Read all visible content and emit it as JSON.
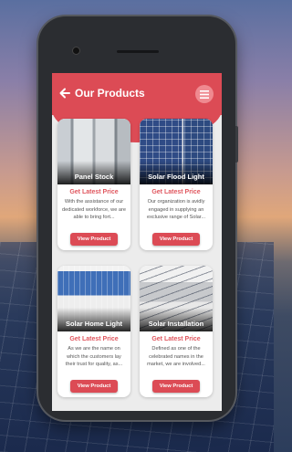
{
  "header": {
    "title": "Our Products",
    "back_icon": "arrow-left-icon",
    "menu_icon": "hamburger-menu-icon"
  },
  "colors": {
    "accent": "#dc4b55",
    "price": "#e0565e",
    "screen_bg": "#ececec"
  },
  "products": [
    {
      "name": "Panel Stock",
      "price_label": "Get Latest Price",
      "description": "With the assistance of our dedicated workforce, we are able to bring fort...",
      "button_label": "View Product"
    },
    {
      "name": "Solar Flood Light",
      "price_label": "Get Latest Price",
      "description": "Our organization is avidly engaged in supplying an exclusive range of Solar...",
      "button_label": "View Product"
    },
    {
      "name": "Solar Home Light",
      "price_label": "Get Latest Price",
      "description": "As we are the name on which the customers lay their trust for quality, as...",
      "button_label": "View Product"
    },
    {
      "name": "Solar Installation",
      "price_label": "Get Latest Price",
      "description": "Defined as one of the celebrated names in the market, we are involved...",
      "button_label": "View Product"
    }
  ]
}
